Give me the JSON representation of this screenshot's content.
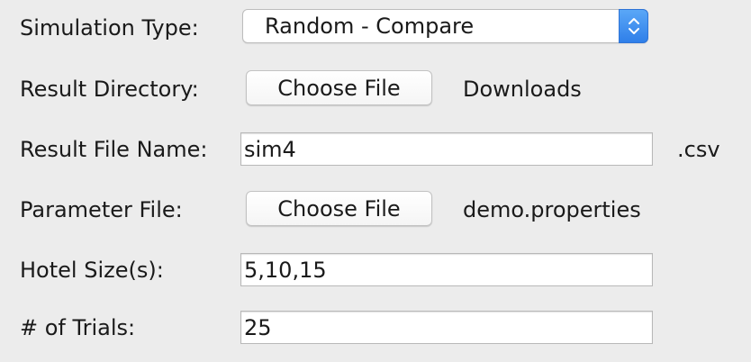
{
  "form": {
    "simulation_type": {
      "label": "Simulation Type:",
      "selected": "Random - Compare"
    },
    "result_directory": {
      "label": "Result Directory:",
      "button_label": "Choose File",
      "chosen": "Downloads"
    },
    "result_file_name": {
      "label": "Result File Name:",
      "value": "sim4",
      "suffix": ".csv"
    },
    "parameter_file": {
      "label": "Parameter File:",
      "button_label": "Choose File",
      "chosen": "demo.properties"
    },
    "hotel_sizes": {
      "label": "Hotel Size(s):",
      "value": "5,10,15"
    },
    "trials": {
      "label": "# of Trials:",
      "value": "25"
    }
  },
  "icons": {
    "select_arrows": "chevron-up-down-icon"
  },
  "colors": {
    "background": "#ececec",
    "accent": "#3a8ff0"
  }
}
